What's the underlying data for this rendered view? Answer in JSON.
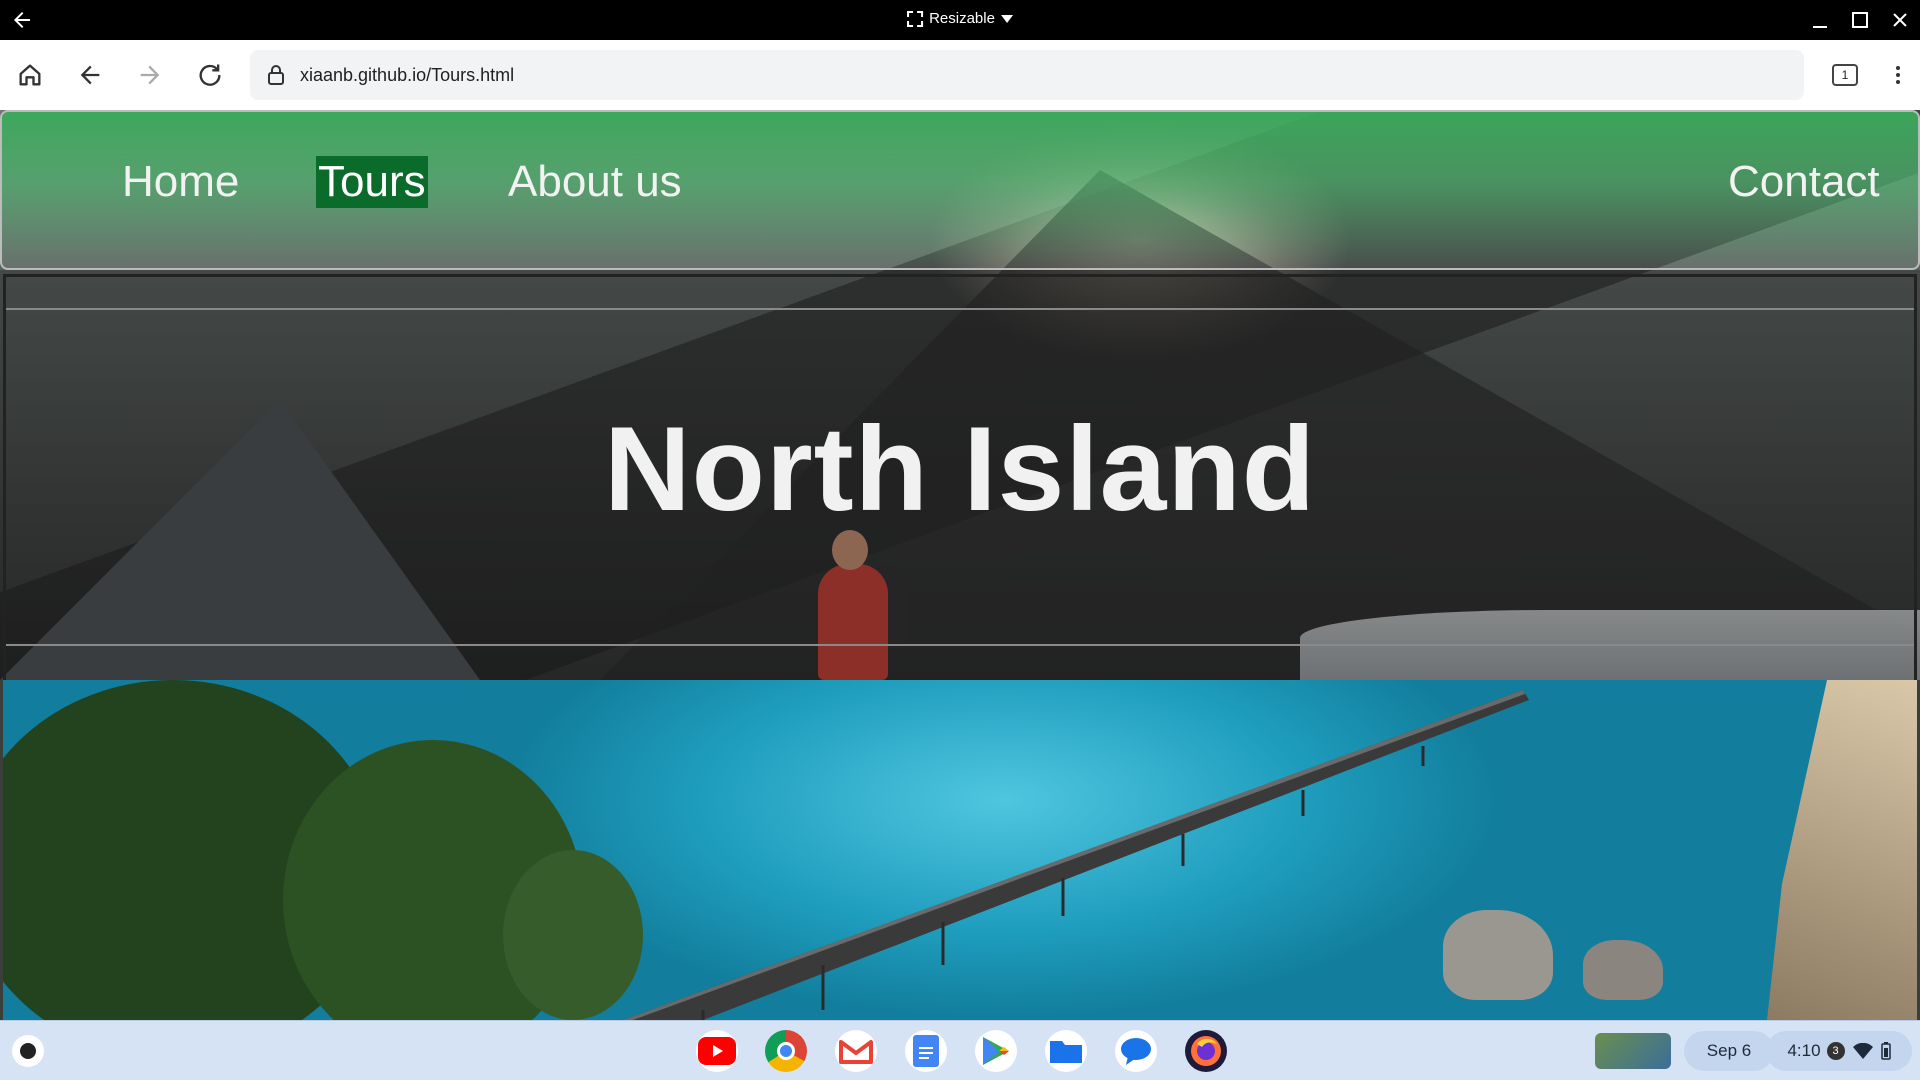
{
  "window": {
    "title": "Resizable",
    "back_icon": "arrow-left-icon",
    "controls": [
      "minimize-icon",
      "maximize-icon",
      "close-icon"
    ]
  },
  "browser": {
    "url": "xiaanb.github.io/Tours.html",
    "tab_count": "1",
    "icons": [
      "home-icon",
      "back-icon",
      "forward-icon",
      "reload-icon",
      "lock-icon",
      "tabs-icon",
      "more-icon"
    ]
  },
  "nav": {
    "items": [
      {
        "label": "Home",
        "active": false
      },
      {
        "label": "Tours",
        "active": true
      },
      {
        "label": "About us",
        "active": false
      },
      {
        "label": "Contact",
        "active": false
      }
    ]
  },
  "hero": {
    "heading": "North Island"
  },
  "colors": {
    "nav_active_bg": "#0b6b2a",
    "nav_green": "#3aaa5a",
    "heading_text": "#f1f1f1"
  },
  "shelf": {
    "apps": [
      "YouTube",
      "Chrome",
      "Gmail",
      "Docs",
      "Play Store",
      "Files",
      "Messages",
      "Firefox"
    ],
    "date": "Sep 6",
    "time": "4:10",
    "notification_count": "3",
    "tray_icons": [
      "wifi-icon",
      "battery-icon"
    ]
  }
}
